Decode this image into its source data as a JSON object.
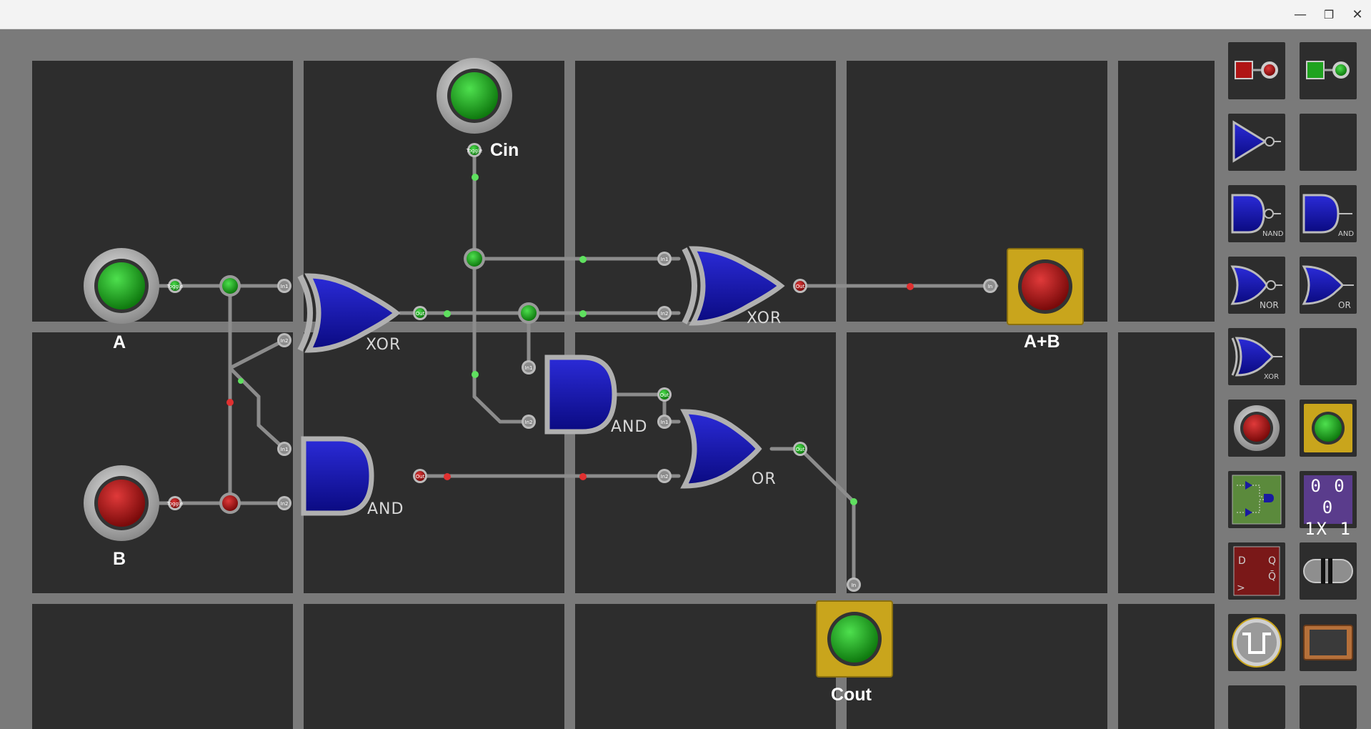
{
  "window": {
    "minimize_glyph": "—",
    "maximize_glyph": "❐",
    "close_glyph": "✕"
  },
  "circuit": {
    "inputs": [
      {
        "label": "A",
        "state": "on"
      },
      {
        "label": "B",
        "state": "off"
      },
      {
        "label": "Cin",
        "state": "on"
      }
    ],
    "outputs": [
      {
        "label": "A+B",
        "state": "off"
      },
      {
        "label": "Cout",
        "state": "on"
      }
    ],
    "gates": [
      {
        "type": "XOR",
        "label": "XOR"
      },
      {
        "type": "AND",
        "label": "AND"
      },
      {
        "type": "XOR",
        "label": "XOR"
      },
      {
        "type": "AND",
        "label": "AND"
      },
      {
        "type": "OR",
        "label": "OR"
      }
    ],
    "pin_labels": {
      "toggle": "Toggle",
      "in1": "In1",
      "in2": "In2",
      "out": "Out",
      "in": "In"
    },
    "colors": {
      "wire": "#8c8c8c",
      "on": "#1fa31f",
      "off": "#b01515",
      "gate": "#1010a0",
      "output_box": "#c9a51c"
    }
  },
  "palette": {
    "items": [
      {
        "name": "toggle-input-off",
        "label": ""
      },
      {
        "name": "toggle-input-on",
        "label": ""
      },
      {
        "name": "not-gate",
        "label": ""
      },
      {
        "name": "empty-slot",
        "label": ""
      },
      {
        "name": "nand-gate",
        "label": "NAND"
      },
      {
        "name": "and-gate",
        "label": "AND"
      },
      {
        "name": "nor-gate",
        "label": "NOR"
      },
      {
        "name": "or-gate",
        "label": "OR"
      },
      {
        "name": "xor-gate",
        "label": "XOR"
      },
      {
        "name": "empty-slot",
        "label": ""
      },
      {
        "name": "push-button",
        "label": ""
      },
      {
        "name": "output-light",
        "label": ""
      },
      {
        "name": "sub-circuit",
        "label": ""
      },
      {
        "name": "counter-display",
        "label": ""
      },
      {
        "name": "d-flip-flop",
        "label": ""
      },
      {
        "name": "wire-bundle",
        "label": ""
      },
      {
        "name": "clock",
        "label": ""
      },
      {
        "name": "display-frame",
        "label": ""
      }
    ],
    "counter_line1": "0 0 0",
    "counter_line2": "1X 1",
    "dff_d": "D",
    "dff_q": "Q",
    "dff_qbar": "Q̄",
    "dff_clk": ">"
  }
}
